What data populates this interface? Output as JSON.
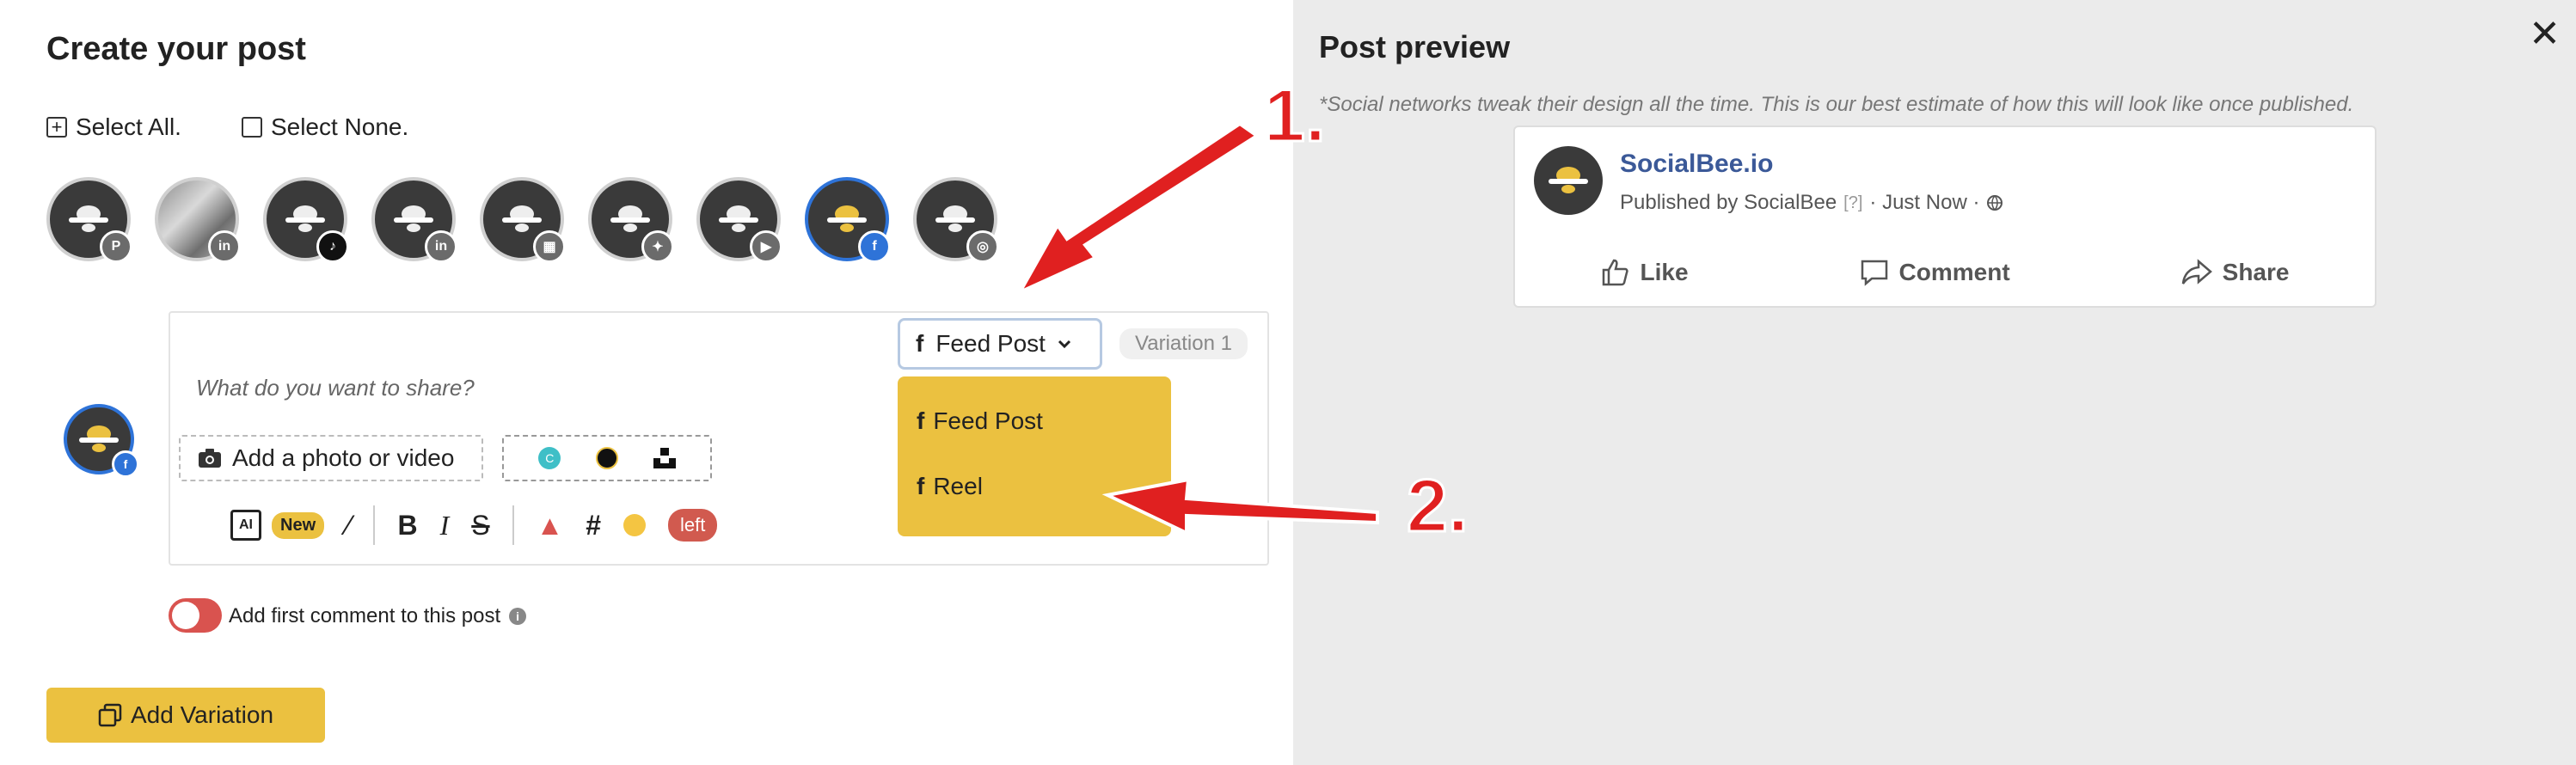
{
  "compose": {
    "title": "Create your post",
    "select_all": "Select All.",
    "select_none": "Select None.",
    "profiles": [
      {
        "network": "pinterest",
        "badge": "P",
        "color": "#6b6b6b"
      },
      {
        "network": "linkedin",
        "badge": "in",
        "color": "#6b6b6b"
      },
      {
        "network": "tiktok",
        "badge": "♪",
        "color": "#111111"
      },
      {
        "network": "linkedin",
        "badge": "in",
        "color": "#6b6b6b"
      },
      {
        "network": "google-business",
        "badge": "▦",
        "color": "#6b6b6b"
      },
      {
        "network": "twitter",
        "badge": "✦",
        "color": "#6b6b6b"
      },
      {
        "network": "youtube",
        "badge": "▶",
        "color": "#6b6b6b"
      },
      {
        "network": "facebook",
        "badge": "f",
        "color": "#2e73d8"
      },
      {
        "network": "instagram",
        "badge": "◎",
        "color": "#6b6b6b"
      }
    ],
    "placeholder": "What do you want to share?",
    "post_type": "Feed Post",
    "variation_label": "Variation 1",
    "dropdown": [
      "Feed Post",
      "Reel"
    ],
    "add_photo": "Add a photo or video",
    "ai_new": "New",
    "left_badge": "left",
    "first_comment": "Add first comment to this post",
    "add_variation": "Add Variation"
  },
  "preview": {
    "title": "Post preview",
    "note": "*Social networks tweak their design all the time. This is our best estimate of how this will look like once published.",
    "page_name": "SocialBee.io",
    "published_by": "Published by SocialBee",
    "qm": "[?]",
    "time": "· Just Now ·",
    "actions": {
      "like": "Like",
      "comment": "Comment",
      "share": "Share"
    }
  },
  "annotations": {
    "one": "1.",
    "two": "2."
  },
  "colors": {
    "accent": "#ebc140",
    "facebook": "#2e73d8",
    "arrow": "#e02020",
    "toggle": "#d9534f"
  }
}
